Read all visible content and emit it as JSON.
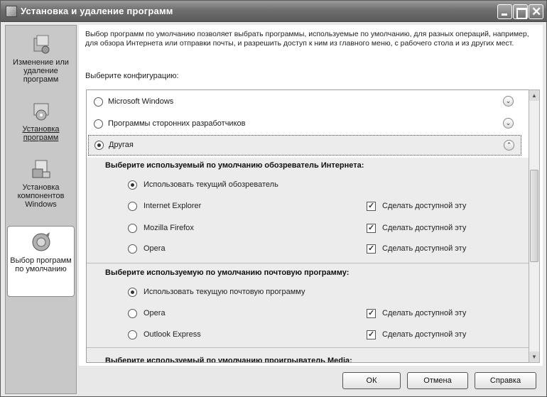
{
  "window": {
    "title": "Установка и удаление программ"
  },
  "sidebar": {
    "items": [
      {
        "label": "Изменение или удаление программ",
        "icon": "change-remove-icon"
      },
      {
        "label": "Установка программ",
        "icon": "install-icon"
      },
      {
        "label": "Установка компонентов Windows",
        "icon": "windows-components-icon"
      },
      {
        "label": "Выбор программ по умолчанию",
        "icon": "default-programs-icon"
      }
    ]
  },
  "main": {
    "description": "Выбор программ по умолчанию позволяет выбрать программы, используемые по умолчанию, для разных операций, например, для обзора Интернета или отправки почты, и разрешить доступ к ним из главного меню, с рабочего стола и из других мест.",
    "choose_label": "Выберите конфигурацию:",
    "configs": [
      {
        "label": "Microsoft Windows",
        "selected": false
      },
      {
        "label": "Программы сторонних разработчиков",
        "selected": false
      },
      {
        "label": "Другая",
        "selected": true
      }
    ],
    "browser_section": {
      "title": "Выберите используемый по умолчанию обозреватель Интернета:",
      "options": [
        {
          "label": "Использовать текущий обозреватель",
          "selected": true
        },
        {
          "label": "Internet Explorer",
          "selected": false,
          "checkbox": "Сделать доступной эту"
        },
        {
          "label": "Mozilla Firefox",
          "selected": false,
          "checkbox": "Сделать доступной эту"
        },
        {
          "label": "Opera",
          "selected": false,
          "checkbox": "Сделать доступной эту"
        }
      ]
    },
    "mail_section": {
      "title": "Выберите используемую по умолчанию почтовую программу:",
      "options": [
        {
          "label": "Использовать текущую почтовую программу",
          "selected": true
        },
        {
          "label": "Opera",
          "selected": false,
          "checkbox": "Сделать доступной эту"
        },
        {
          "label": "Outlook Express",
          "selected": false,
          "checkbox": "Сделать доступной эту"
        }
      ]
    },
    "media_section": {
      "title": "Выберите используемый по умолчанию проигрыватель Media:"
    }
  },
  "buttons": {
    "ok": "ОК",
    "cancel": "Отмена",
    "help": "Справка"
  }
}
